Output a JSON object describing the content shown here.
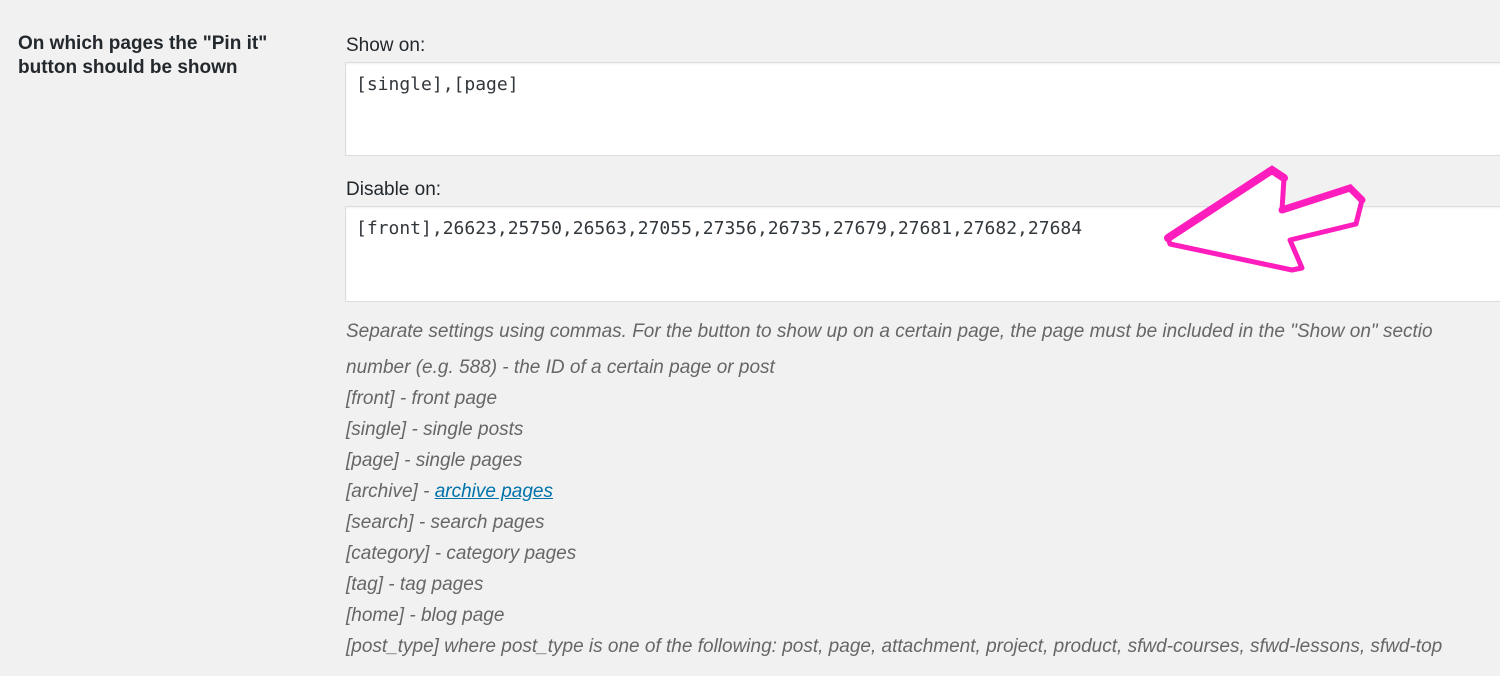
{
  "setting": {
    "label_line1": "On which pages the \"Pin it\"",
    "label_line2": "button should be shown"
  },
  "show_on": {
    "label": "Show on:",
    "value": "[single],[page]"
  },
  "disable_on": {
    "label": "Disable on:",
    "value": "[front],26623,25750,26563,27055,27356,26735,27679,27681,27682,27684"
  },
  "help": {
    "intro": "Separate settings using commas. For the button to show up on a certain page, the page must be included in the \"Show on\" sectio",
    "lines": [
      "number (e.g. 588) - the ID of a certain page or post",
      "[front] - front page",
      "[single] - single posts",
      "[page] - single pages",
      "[archive] - ",
      "[search] - search pages",
      "[category] - category pages",
      "[tag] - tag pages",
      "[home] - blog page",
      "[post_type] where post_type is one of the following: post, page, attachment, project, product, sfwd-courses, sfwd-lessons, sfwd-top"
    ],
    "archive_link": "archive pages"
  },
  "annotation": {
    "icon": "arrow-icon",
    "color": "#ff1dbd"
  }
}
